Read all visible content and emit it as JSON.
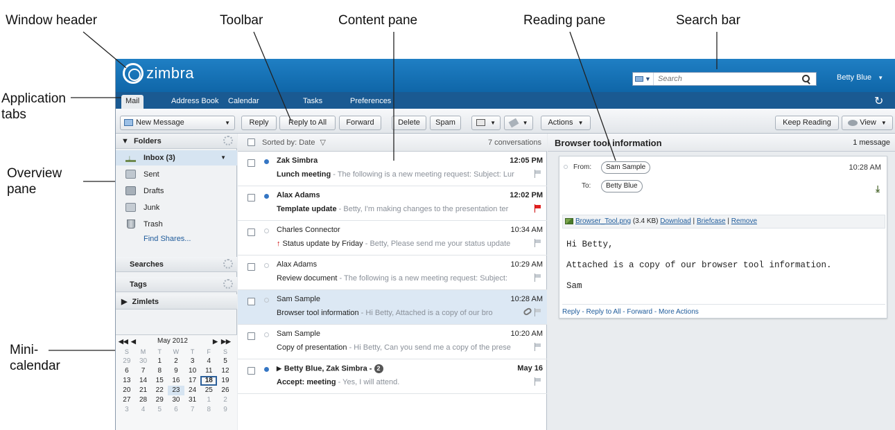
{
  "callouts": {
    "window_header": "Window header",
    "toolbar": "Toolbar",
    "content_pane": "Content pane",
    "reading_pane": "Reading pane",
    "search_bar": "Search bar",
    "application_tabs_1": "Application",
    "application_tabs_2": "tabs",
    "overview_pane_1": "Overview",
    "overview_pane_2": "pane",
    "mini_calendar_1": "Mini-",
    "mini_calendar_2": "calendar"
  },
  "header": {
    "logo_text": "zimbra",
    "search_placeholder": "Search",
    "user_name": "Betty Blue"
  },
  "tabs": [
    "Mail",
    "Address Book",
    "Calendar",
    "Tasks",
    "Preferences"
  ],
  "toolbar": {
    "new_message": "New Message",
    "reply": "Reply",
    "reply_all": "Reply to All",
    "forward": "Forward",
    "delete": "Delete",
    "spam": "Spam",
    "actions": "Actions",
    "keep_reading": "Keep Reading",
    "view": "View"
  },
  "overview": {
    "folders_header": "Folders",
    "folders": [
      {
        "name": "Inbox (3)",
        "icon": "inbox-icon"
      },
      {
        "name": "Sent",
        "icon": "sent-icon"
      },
      {
        "name": "Drafts",
        "icon": "drafts-icon"
      },
      {
        "name": "Junk",
        "icon": "junk-icon"
      },
      {
        "name": "Trash",
        "icon": "trash-icon"
      }
    ],
    "find_shares": "Find Shares...",
    "searches": "Searches",
    "tags": "Tags",
    "zimlets": "Zimlets"
  },
  "calendar": {
    "title": "May 2012",
    "weekdays": [
      "S",
      "M",
      "T",
      "W",
      "T",
      "F",
      "S"
    ],
    "weeks": [
      [
        "29",
        "30",
        "1",
        "2",
        "3",
        "4",
        "5"
      ],
      [
        "6",
        "7",
        "8",
        "9",
        "10",
        "11",
        "12"
      ],
      [
        "13",
        "14",
        "15",
        "16",
        "17",
        "18",
        "19"
      ],
      [
        "20",
        "21",
        "22",
        "23",
        "24",
        "25",
        "26"
      ],
      [
        "27",
        "28",
        "29",
        "30",
        "31",
        "1",
        "2"
      ],
      [
        "3",
        "4",
        "5",
        "6",
        "7",
        "8",
        "9"
      ]
    ],
    "today": "18"
  },
  "list": {
    "sorted_by": "Sorted by: Date",
    "count": "7 conversations",
    "messages": [
      {
        "from": "Zak Simbra",
        "time": "12:05 PM",
        "subject": "Lunch meeting",
        "fragment": " - The following is a new meeting request: Subject: Lur"
      },
      {
        "from": "Alax Adams",
        "time": "12:02 PM",
        "subject": "Template update",
        "fragment": " - Betty, I'm making changes to the presentation ter"
      },
      {
        "from": "Charles Connector",
        "time": "10:34 AM",
        "subject": "Status update by Friday",
        "fragment": " - Betty, Please send me your status update"
      },
      {
        "from": "Alax Adams",
        "time": "10:29 AM",
        "subject": "Review document",
        "fragment": " - The following is a new meeting request: Subject:"
      },
      {
        "from": "Sam Sample",
        "time": "10:28 AM",
        "subject": "Browser tool information",
        "fragment": " - Hi Betty, Attached is a copy of our bro"
      },
      {
        "from": "Sam Sample",
        "time": "10:20 AM",
        "subject": "Copy of presentation",
        "fragment": " - Hi Betty, Can you send me a copy of the prese"
      },
      {
        "from": "Betty Blue, Zak Simbra -",
        "thread_count": "2",
        "time": "May 16",
        "subject": "Accept: meeting",
        "fragment": " - Yes, I will attend."
      }
    ]
  },
  "reading": {
    "title": "Browser tool information",
    "count": "1 message",
    "from_label": "From:",
    "from": "Sam Sample",
    "to_label": "To:",
    "to": "Betty Blue",
    "time": "10:28 AM",
    "attachment_name": "Browser_Tool.png",
    "attachment_size": "(3.4 KB)",
    "download": "Download",
    "briefcase": "Briefcase",
    "remove": "Remove",
    "body": [
      "Hi Betty,",
      "Attached is a copy of our browser tool information.",
      "Sam"
    ],
    "actions": [
      "Reply",
      "Reply to All",
      "Forward",
      "More Actions"
    ]
  },
  "colors": {
    "header_blue": "#1f7fc4",
    "tab_bar": "#1a5a92",
    "selection": "#dce8f4",
    "unread_dot": "#3576c4",
    "flag_red": "#e02020"
  }
}
